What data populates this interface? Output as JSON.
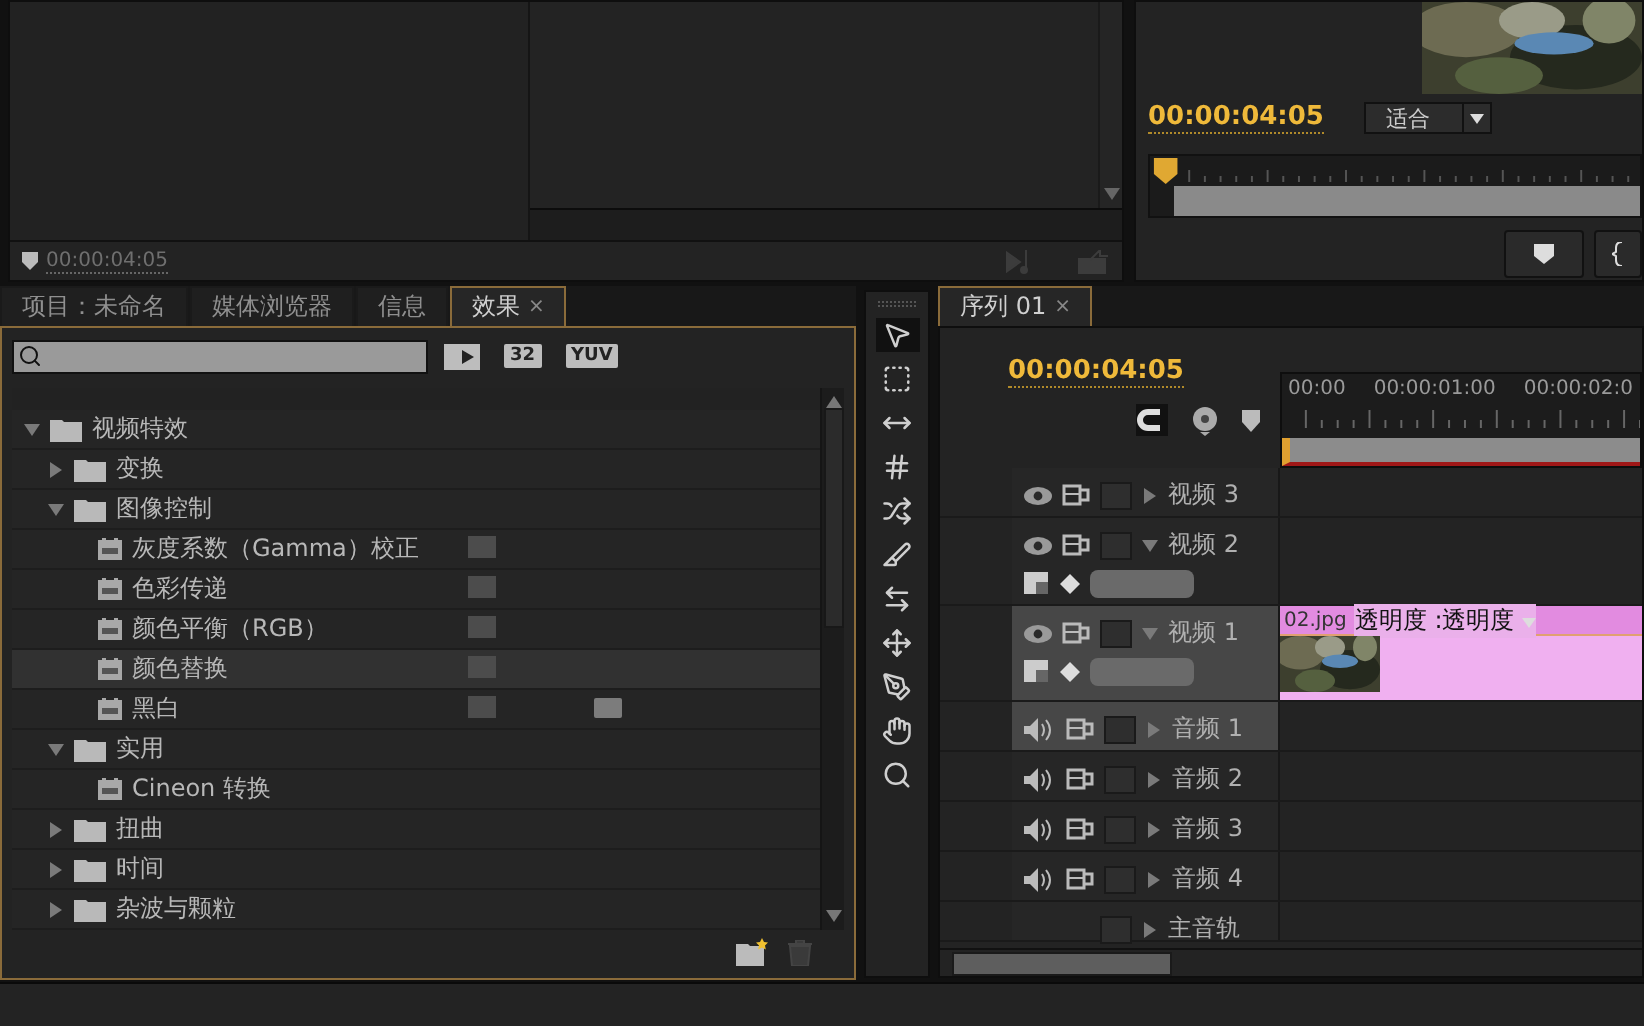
{
  "source_monitor": {
    "timecode": "00:00:04:05"
  },
  "program_monitor": {
    "timecode": "00:00:04:05",
    "zoom": "适合"
  },
  "effects_panel": {
    "tabs": [
      {
        "label": "项目：未命名",
        "selected": false
      },
      {
        "label": "媒体浏览器",
        "selected": false
      },
      {
        "label": "信息",
        "selected": false
      },
      {
        "label": "效果",
        "selected": true,
        "close": "×"
      }
    ],
    "filters": [
      "32",
      "YUV"
    ],
    "tree": [
      {
        "kind": "folder",
        "label": "视频特效",
        "expanded": true,
        "selected": false,
        "children": [
          {
            "kind": "folder",
            "label": "变换",
            "expanded": false,
            "selected": false
          },
          {
            "kind": "folder",
            "label": "图像控制",
            "expanded": true,
            "selected": false,
            "children": [
              {
                "kind": "effect",
                "label": "灰度系数（Gamma）校正",
                "selected": false,
                "accelerated": true,
                "yuv": false
              },
              {
                "kind": "effect",
                "label": "色彩传递",
                "selected": false,
                "accelerated": true,
                "yuv": false
              },
              {
                "kind": "effect",
                "label": "颜色平衡（RGB）",
                "selected": false,
                "accelerated": true,
                "yuv": false
              },
              {
                "kind": "effect",
                "label": "颜色替换",
                "selected": true,
                "accelerated": true,
                "yuv": false
              },
              {
                "kind": "effect",
                "label": "黑白",
                "selected": false,
                "accelerated": true,
                "yuv": true
              }
            ]
          },
          {
            "kind": "folder",
            "label": "实用",
            "expanded": true,
            "selected": false,
            "children": [
              {
                "kind": "effect",
                "label": "Cineon 转换",
                "selected": false,
                "accelerated": false,
                "yuv": false
              }
            ]
          },
          {
            "kind": "folder",
            "label": "扭曲",
            "expanded": false,
            "selected": false
          },
          {
            "kind": "folder",
            "label": "时间",
            "expanded": false,
            "selected": false
          },
          {
            "kind": "folder",
            "label": "杂波与颗粒",
            "expanded": false,
            "selected": false
          }
        ]
      }
    ]
  },
  "sequence": {
    "tab": "序列 01",
    "close": "×",
    "timecode": "00:00:04:05",
    "ruler": [
      "00:00",
      "00:00:01:00",
      "00:00:02:0"
    ],
    "tracks": [
      {
        "kind": "video",
        "name": "视频 3",
        "expanded": false,
        "selected": false
      },
      {
        "kind": "video",
        "name": "视频 2",
        "expanded": true,
        "selected": false
      },
      {
        "kind": "video",
        "name": "视频 1",
        "expanded": true,
        "selected": true,
        "clip": {
          "name": "02.jpg",
          "property": "透明度 :透明度"
        }
      },
      {
        "kind": "audio",
        "name": "音频 1",
        "expanded": false,
        "selected": true
      },
      {
        "kind": "audio",
        "name": "音频 2",
        "expanded": false,
        "selected": false
      },
      {
        "kind": "audio",
        "name": "音频 3",
        "expanded": false,
        "selected": false
      },
      {
        "kind": "audio",
        "name": "音频 4",
        "expanded": false,
        "selected": false
      },
      {
        "kind": "master",
        "name": "主音轨",
        "expanded": false,
        "selected": false
      }
    ]
  }
}
